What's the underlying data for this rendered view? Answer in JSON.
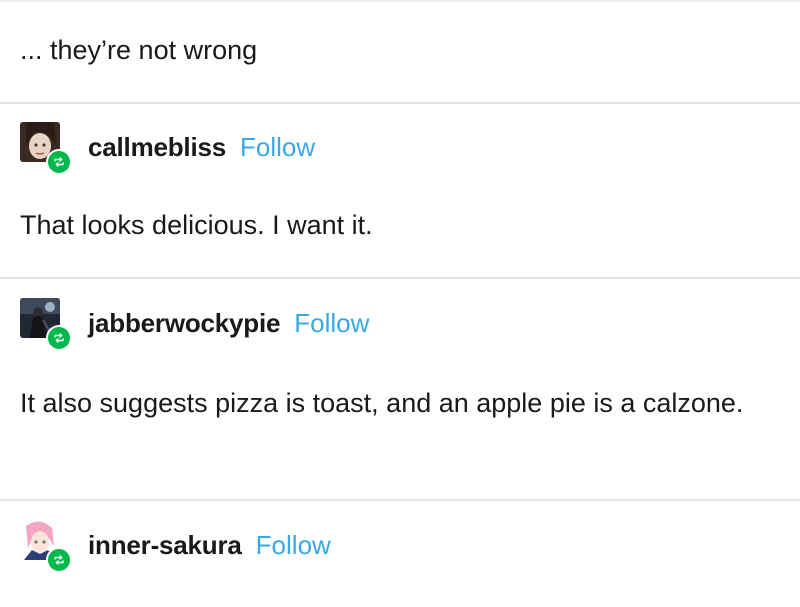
{
  "post": {
    "intro_text": "... they’re not wrong",
    "reblogs": [
      {
        "username": "callmebliss",
        "follow_label": "Follow",
        "text": "That looks delicious. I want it.",
        "avatar_icon": "avatar-dark-hair-portrait",
        "badge_icon": "reblog-icon"
      },
      {
        "username": "jabberwockypie",
        "follow_label": "Follow",
        "text": "It also suggests pizza is toast, and an apple pie is a calzone.",
        "avatar_icon": "avatar-dark-figure",
        "badge_icon": "reblog-icon"
      },
      {
        "username": "inner-sakura",
        "follow_label": "Follow",
        "avatar_icon": "avatar-pink-hair-anime",
        "badge_icon": "reblog-icon"
      }
    ]
  },
  "colors": {
    "follow": "#39a8e6",
    "reblog_badge": "#00b94a",
    "divider": "#e3e3e3",
    "text": "#1a1a1a"
  }
}
